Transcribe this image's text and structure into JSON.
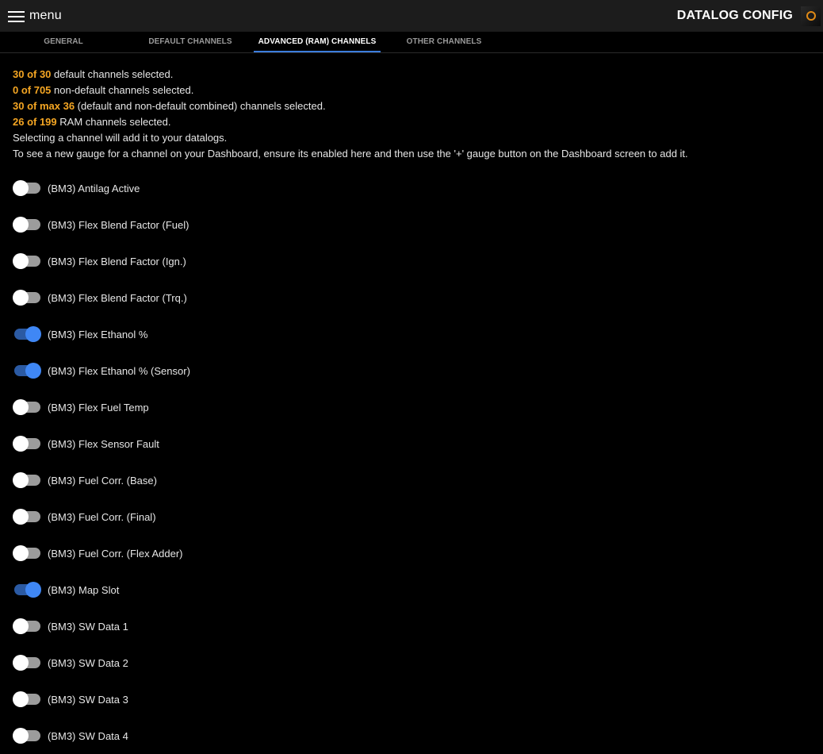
{
  "header": {
    "menu_label": "menu",
    "title": "DATALOG CONFIG",
    "status_icon": "status-ring-icon",
    "status_color": "#e08a16"
  },
  "tabs": [
    {
      "label": "GENERAL",
      "active": false
    },
    {
      "label": "DEFAULT CHANNELS",
      "active": false
    },
    {
      "label": "ADVANCED (RAM) CHANNELS",
      "active": true
    },
    {
      "label": "OTHER CHANNELS",
      "active": false
    }
  ],
  "summary": {
    "lines": [
      {
        "highlight": "30 of 30",
        "text": " default channels selected."
      },
      {
        "highlight": "0 of 705",
        "text": " non-default channels selected."
      },
      {
        "highlight": "30 of max 36",
        "text": " (default and non-default combined) channels selected."
      },
      {
        "highlight": "26 of 199",
        "text": " RAM channels selected."
      }
    ],
    "note1": "Selecting a channel will add it to your datalogs.",
    "note2": "To see a new gauge for a channel on your Dashboard, ensure its enabled here and then use the '+' gauge button on the Dashboard screen to add it.",
    "highlight_color": "#f5a623"
  },
  "channels": [
    {
      "label": "(BM3) Antilag Active",
      "enabled": false
    },
    {
      "label": "(BM3) Flex Blend Factor (Fuel)",
      "enabled": false
    },
    {
      "label": "(BM3) Flex Blend Factor (Ign.)",
      "enabled": false
    },
    {
      "label": "(BM3) Flex Blend Factor (Trq.)",
      "enabled": false
    },
    {
      "label": "(BM3) Flex Ethanol %",
      "enabled": true
    },
    {
      "label": "(BM3) Flex Ethanol % (Sensor)",
      "enabled": true
    },
    {
      "label": "(BM3) Flex Fuel Temp",
      "enabled": false
    },
    {
      "label": "(BM3) Flex Sensor Fault",
      "enabled": false
    },
    {
      "label": "(BM3) Fuel Corr. (Base)",
      "enabled": false
    },
    {
      "label": "(BM3) Fuel Corr. (Final)",
      "enabled": false
    },
    {
      "label": "(BM3) Fuel Corr. (Flex Adder)",
      "enabled": false
    },
    {
      "label": "(BM3) Map Slot",
      "enabled": true
    },
    {
      "label": "(BM3) SW Data 1",
      "enabled": false
    },
    {
      "label": "(BM3) SW Data 2",
      "enabled": false
    },
    {
      "label": "(BM3) SW Data 3",
      "enabled": false
    },
    {
      "label": "(BM3) SW Data 4",
      "enabled": false
    }
  ],
  "colors": {
    "toggle_on_thumb": "#3f87f5",
    "toggle_on_track": "#2b5aa3",
    "toggle_off_thumb": "#ffffff",
    "toggle_off_track": "#9c9c9c",
    "tab_indicator": "#3b7ddd"
  }
}
